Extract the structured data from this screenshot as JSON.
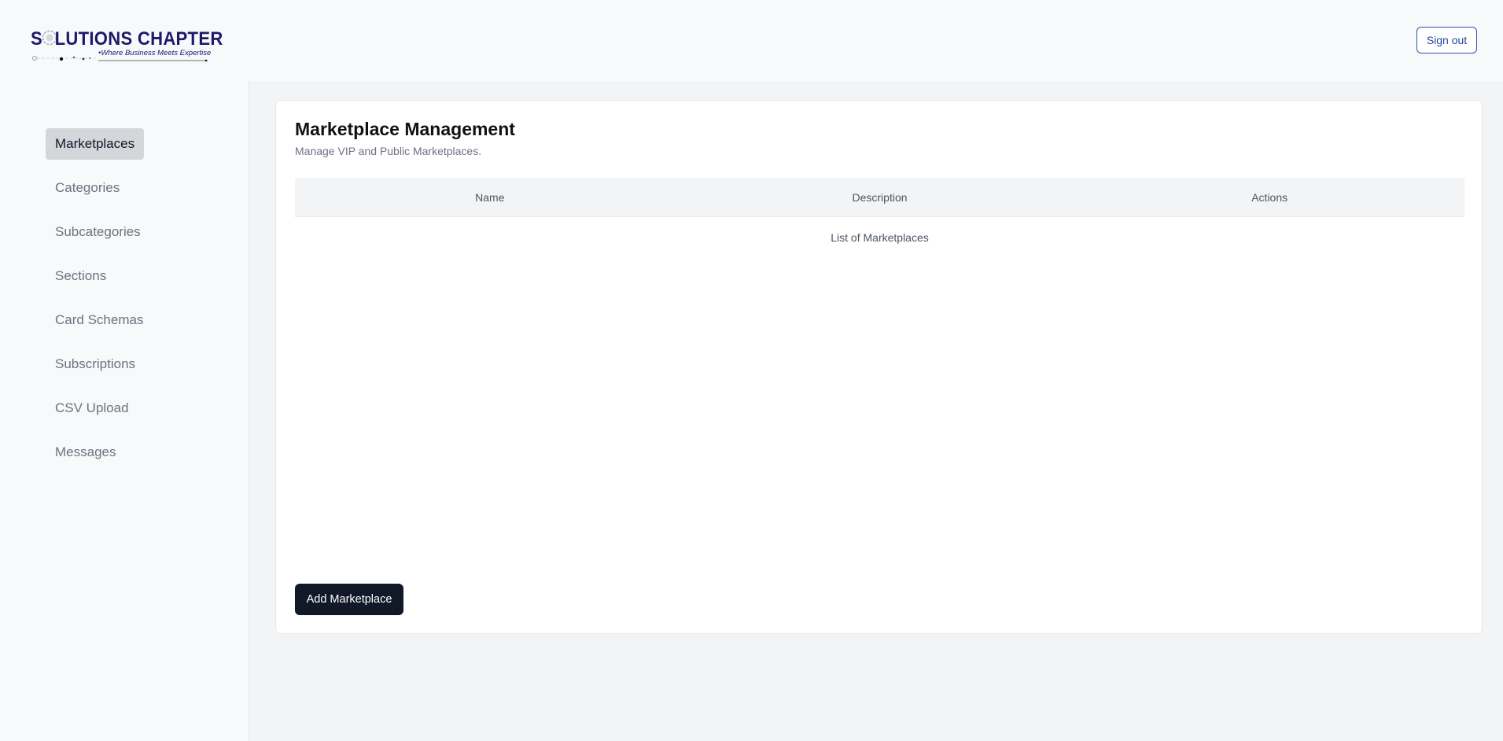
{
  "header": {
    "logo_text": "SOLUTIONS CHAPTER",
    "logo_tagline": "Where Business Meets Expertise",
    "signout_label": "Sign out"
  },
  "sidebar": {
    "items": [
      {
        "label": "Marketplaces",
        "active": true
      },
      {
        "label": "Categories",
        "active": false
      },
      {
        "label": "Subcategories",
        "active": false
      },
      {
        "label": "Sections",
        "active": false
      },
      {
        "label": "Card Schemas",
        "active": false
      },
      {
        "label": "Subscriptions",
        "active": false
      },
      {
        "label": "CSV Upload",
        "active": false
      },
      {
        "label": "Messages",
        "active": false
      }
    ]
  },
  "main": {
    "title": "Marketplace Management",
    "subtitle": "Manage VIP and Public Marketplaces.",
    "table": {
      "columns": [
        "Name",
        "Description",
        "Actions"
      ],
      "empty_text": "List of Marketplaces"
    },
    "add_button_label": "Add Marketplace"
  },
  "colors": {
    "brand": "#1d1a6b",
    "primary_button": "#111827",
    "signout_border": "#2b55a8",
    "active_nav": "#d4d6da"
  }
}
